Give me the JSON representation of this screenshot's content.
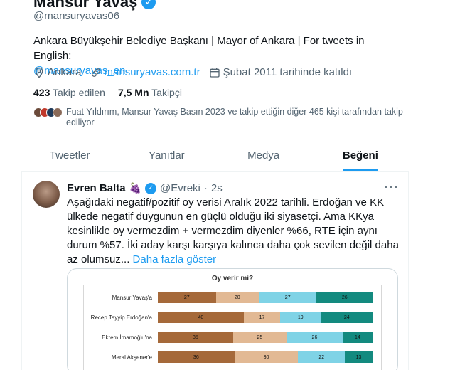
{
  "profile": {
    "name": "Mansur Yavaş",
    "handle": "@mansuryavas06",
    "bio": "Ankara Büyükşehir Belediye Başkanı | Mayor of Ankara | For tweets in English:",
    "bio_link": "@mansuryavas_en",
    "location": "Ankara",
    "website": "mansuryavas.com.tr",
    "joined": "Şubat 2011 tarihinde katıldı",
    "following_count": "423",
    "following_label": "Takip edilen",
    "followers_count": "7,5 Mn",
    "followers_label": "Takipçi",
    "followed_by": "Fuat Yıldırım, Mansur Yavaş Basın 2023 ve takip ettiğin diğer 465 kişi tarafından takip ediliyor"
  },
  "tabs": [
    {
      "label": "Tweetler"
    },
    {
      "label": "Yanıtlar"
    },
    {
      "label": "Medya"
    },
    {
      "label": "Beğeni"
    }
  ],
  "active_tab": "Beğeni",
  "tweet": {
    "author": "Evren Balta",
    "emoji": "🍇",
    "handle": "@Evreki",
    "sep": "·",
    "time": "2s",
    "more": "···",
    "text": "Aşağıdaki negatif/pozitif oy verisi Aralık 2022 tarihli. Erdoğan ve KK ülkede negatif duygunun en güçlü olduğu iki siyasetçi. Ama KKya kesinlikle oy vermezdim + vermezdim diyenler %66, RTE için aynı durum %57. İki aday karşı karşıya kalınca daha çok sevilen değil daha az olumsuz...",
    "show_more": "Daha fazla göster"
  },
  "colors": {
    "accent": "#1d9bf0",
    "seg1": "#a5693a",
    "seg2": "#e2b994",
    "seg3": "#7fd3e6",
    "seg4": "#138a7f"
  },
  "chart_data": {
    "type": "bar",
    "title": "Oy verir mi?",
    "categories": [
      "Mansur Yavaş'a",
      "Recep Tayyip Erdoğan'a",
      "Ekrem İmamoğlu'na",
      "Meral Akşener'e"
    ],
    "series": [
      {
        "values": [
          27,
          40,
          35,
          36
        ]
      },
      {
        "values": [
          20,
          17,
          25,
          30
        ]
      },
      {
        "values": [
          27,
          19,
          26,
          22
        ]
      },
      {
        "values": [
          26,
          24,
          14,
          13
        ]
      }
    ]
  }
}
